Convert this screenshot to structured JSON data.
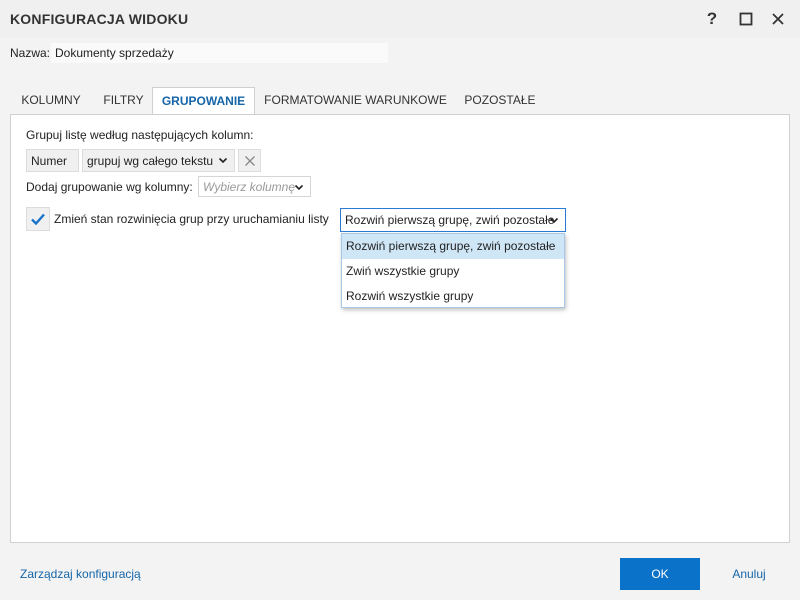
{
  "window": {
    "title": "KONFIGURACJA WIDOKU",
    "help_symbol": "?",
    "icons": {
      "maximize": "maximize-icon",
      "close": "close-icon"
    }
  },
  "name_field": {
    "label": "Nazwa:",
    "value": "Dokumenty sprzedaży"
  },
  "tabs": [
    {
      "label": "KOLUMNY",
      "active": false
    },
    {
      "label": "FILTRY",
      "active": false
    },
    {
      "label": "GRUPOWANIE",
      "active": true
    },
    {
      "label": "FORMATOWANIE WARUNKOWE",
      "active": false
    },
    {
      "label": "POZOSTAŁE",
      "active": false
    }
  ],
  "grouping": {
    "title": "Grupuj listę według następujących kolumn:",
    "group_column": "Numer",
    "group_mode": "grupuj wg całego tekstu",
    "add_label": "Dodaj grupowanie wg kolumny:",
    "add_placeholder": "Wybierz kolumnę",
    "expand_checkbox": {
      "label": "Zmień stan rozwinięcia grup przy uruchamianiu listy",
      "checked": true
    },
    "expand_select": {
      "value": "Rozwiń pierwszą grupę, zwiń pozostałe",
      "options": [
        "Rozwiń pierwszą grupę, zwiń pozostałe",
        "Zwiń wszystkie grupy",
        "Rozwiń wszystkie grupy"
      ],
      "selected_index": 0
    }
  },
  "footer": {
    "manage_link": "Zarządzaj konfiguracją",
    "ok_label": "OK",
    "cancel_label": "Anuluj"
  },
  "colors": {
    "accent": "#0a72c9",
    "link": "#1565a8",
    "selection": "#cfe6f7"
  }
}
